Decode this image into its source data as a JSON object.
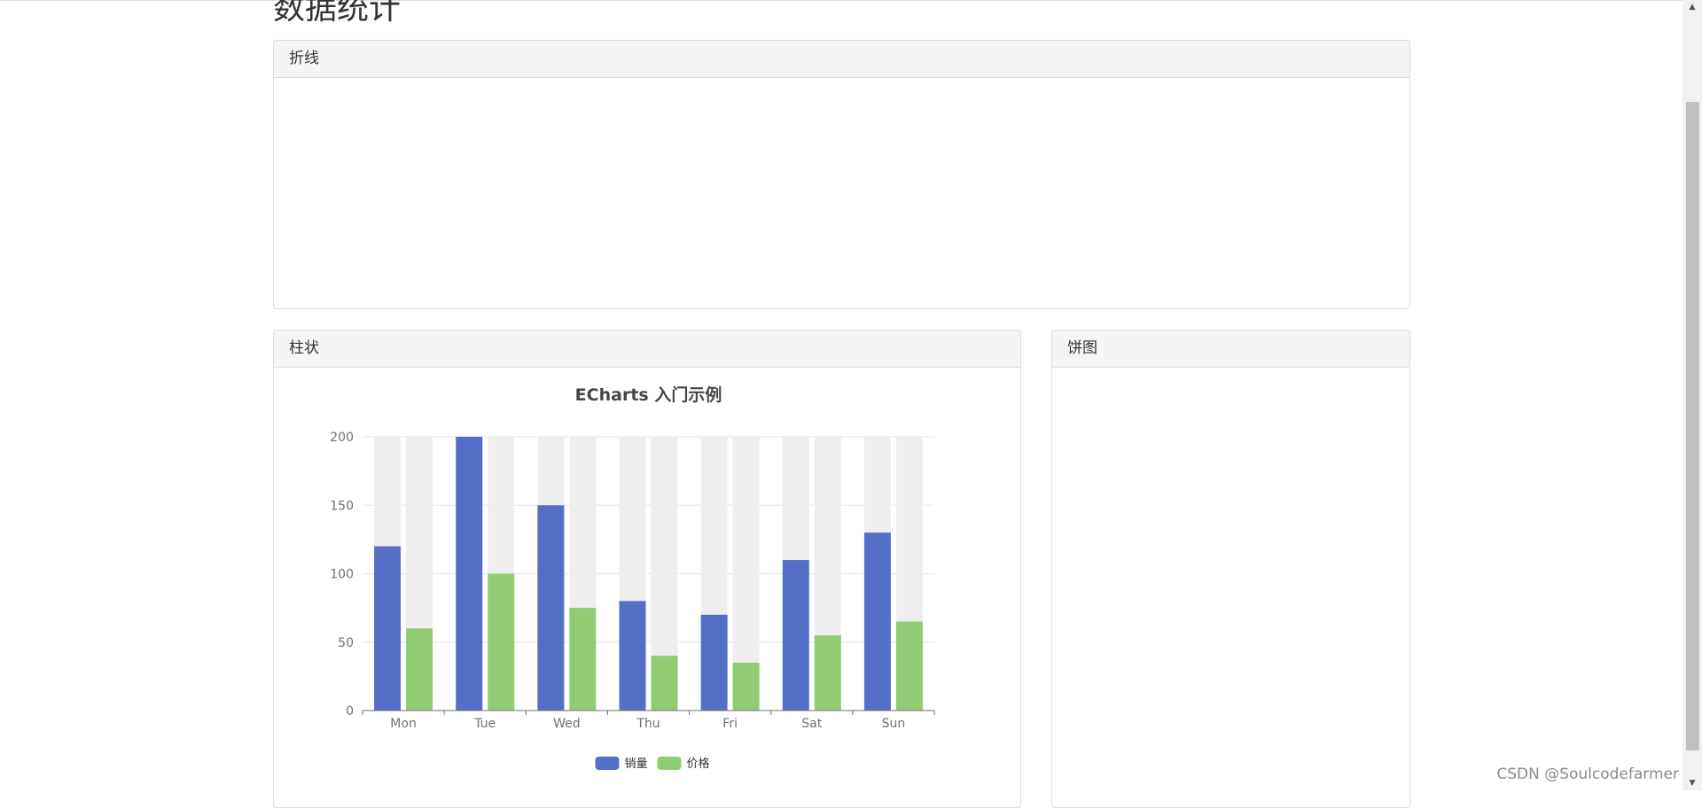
{
  "page": {
    "title": "数据统计"
  },
  "panels": {
    "line": {
      "heading": "折线"
    },
    "bar": {
      "heading": "柱状"
    },
    "pie": {
      "heading": "饼图"
    }
  },
  "chart_data": {
    "type": "bar",
    "title": "ECharts 入门示例",
    "categories": [
      "Mon",
      "Tue",
      "Wed",
      "Thu",
      "Fri",
      "Sat",
      "Sun"
    ],
    "series": [
      {
        "name": "销量",
        "values": [
          120,
          200,
          150,
          80,
          70,
          110,
          130
        ],
        "color": "#5470c6"
      },
      {
        "name": "价格",
        "values": [
          60,
          100,
          75,
          40,
          35,
          55,
          65
        ],
        "color": "#91cc75"
      }
    ],
    "ylim": [
      0,
      200
    ],
    "yticks": [
      0,
      50,
      100,
      150,
      200
    ],
    "background_bar_color": "#eeeeee",
    "grid": true,
    "legend_position": "bottom-center",
    "xlabel": "",
    "ylabel": ""
  },
  "scrollbar": {
    "up_arrow": "▲",
    "down_arrow": "▼"
  },
  "watermark": "CSDN @Soulcodefarmer"
}
